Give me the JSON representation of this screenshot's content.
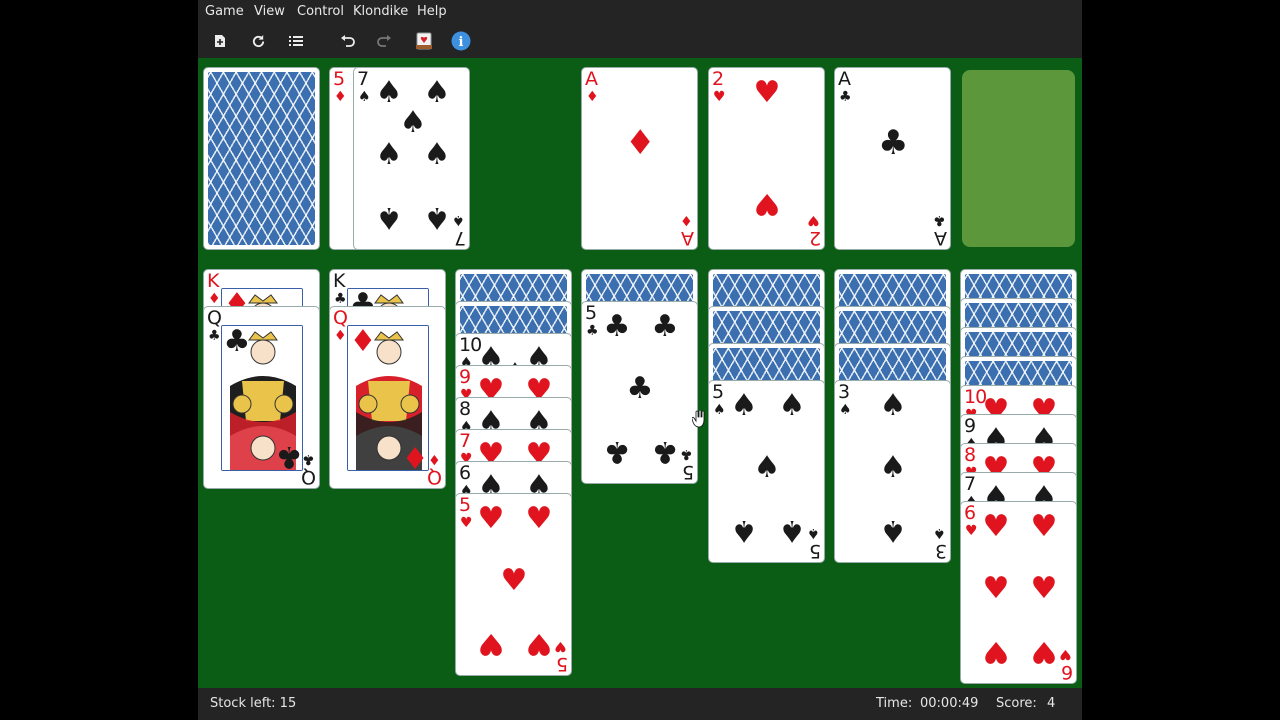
{
  "menu": {
    "items": [
      "Game",
      "View",
      "Control",
      "Klondike",
      "Help"
    ]
  },
  "toolbar": {
    "new_game_icon": "new-game-icon",
    "restart_icon": "restart-icon",
    "select_game_icon": "list-icon",
    "undo_icon": "undo-icon",
    "redo_icon": "redo-icon",
    "hint_icon": "hint-card-icon",
    "info_icon": "info-icon",
    "info_glyph": "i",
    "redo_enabled": false
  },
  "table": {
    "felt_color": "#0b5c14",
    "stock": {
      "face_down": true
    },
    "waste": [
      {
        "rank": "5",
        "suit": "♦",
        "color": "red"
      },
      {
        "rank": "7",
        "suit": "♠",
        "color": "black"
      }
    ],
    "foundations": [
      {
        "rank": "A",
        "suit": "♦",
        "color": "red"
      },
      {
        "rank": "2",
        "suit": "♥",
        "color": "red"
      },
      {
        "rank": "A",
        "suit": "♣",
        "color": "black"
      },
      null
    ],
    "tableau": [
      {
        "face_down": 0,
        "face_up": [
          {
            "rank": "K",
            "suit": "♦",
            "color": "red"
          },
          {
            "rank": "Q",
            "suit": "♣",
            "color": "black"
          }
        ]
      },
      {
        "face_down": 0,
        "face_up": [
          {
            "rank": "K",
            "suit": "♣",
            "color": "black"
          },
          {
            "rank": "Q",
            "suit": "♦",
            "color": "red"
          }
        ]
      },
      {
        "face_down": 2,
        "face_up": [
          {
            "rank": "10",
            "suit": "♠",
            "color": "black"
          },
          {
            "rank": "9",
            "suit": "♥",
            "color": "red"
          },
          {
            "rank": "8",
            "suit": "♠",
            "color": "black"
          },
          {
            "rank": "7",
            "suit": "♥",
            "color": "red"
          },
          {
            "rank": "6",
            "suit": "♠",
            "color": "black"
          },
          {
            "rank": "5",
            "suit": "♥",
            "color": "red"
          }
        ]
      },
      {
        "face_down": 1,
        "face_up": [
          {
            "rank": "5",
            "suit": "♣",
            "color": "black"
          }
        ]
      },
      {
        "face_down": 3,
        "face_up": [
          {
            "rank": "5",
            "suit": "♠",
            "color": "black"
          }
        ]
      },
      {
        "face_down": 3,
        "face_up": [
          {
            "rank": "3",
            "suit": "♠",
            "color": "black"
          }
        ]
      },
      {
        "face_down": 4,
        "face_up": [
          {
            "rank": "10",
            "suit": "♥",
            "color": "red"
          },
          {
            "rank": "9",
            "suit": "♠",
            "color": "black"
          },
          {
            "rank": "8",
            "suit": "♥",
            "color": "red"
          },
          {
            "rank": "7",
            "suit": "♠",
            "color": "black"
          },
          {
            "rank": "6",
            "suit": "♥",
            "color": "red"
          }
        ]
      }
    ]
  },
  "status": {
    "stock_left": "Stock left: 15",
    "time_label": "Time:",
    "time_value": "00:00:49",
    "score_label": "Score:",
    "score_value": "4"
  }
}
